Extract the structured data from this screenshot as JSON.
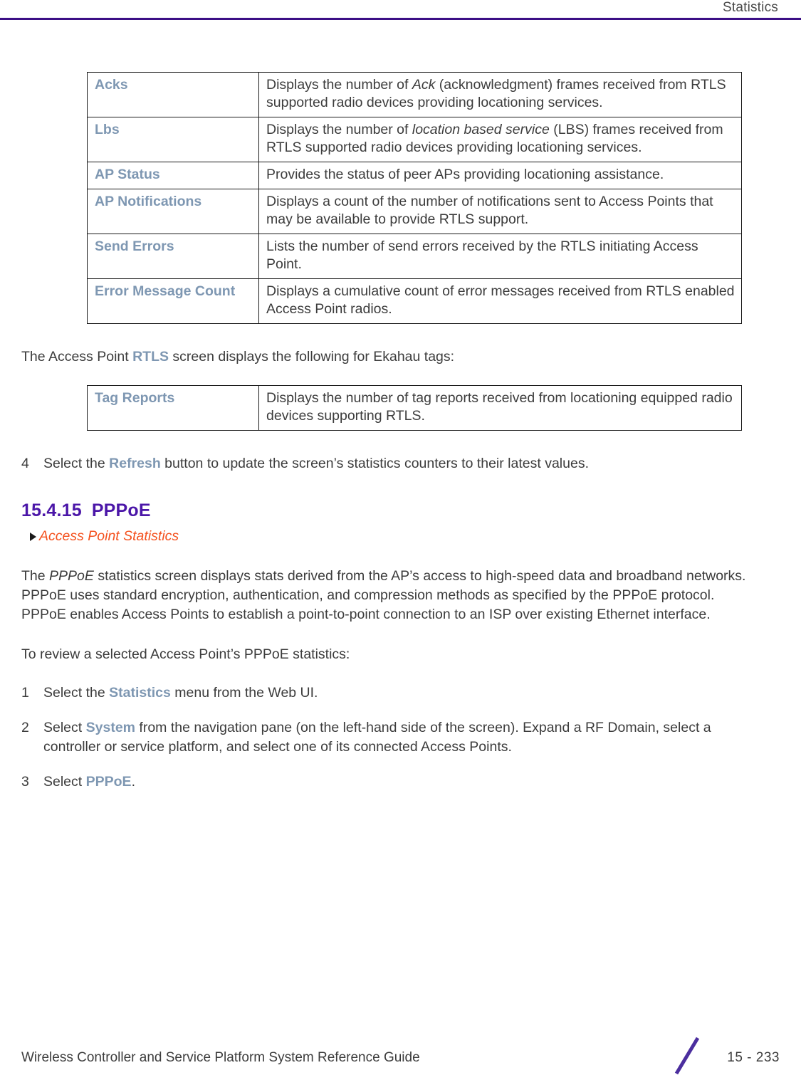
{
  "header": {
    "running_title": "Statistics"
  },
  "tables": [
    {
      "name": "rtls-statistics-table",
      "rows": [
        {
          "term": "Acks",
          "desc_parts": [
            {
              "text": "Displays the number of ",
              "style": "normal"
            },
            {
              "text": "Ack",
              "style": "italic"
            },
            {
              "text": " (acknowledgment) frames received from RTLS supported radio devices providing locationing services.",
              "style": "normal"
            }
          ]
        },
        {
          "term": "Lbs",
          "desc_parts": [
            {
              "text": "Displays the number of ",
              "style": "normal"
            },
            {
              "text": "location based service",
              "style": "italic"
            },
            {
              "text": " (LBS) frames received from RTLS supported radio devices providing locationing services.",
              "style": "normal"
            }
          ]
        },
        {
          "term": "AP Status",
          "desc_parts": [
            {
              "text": "Provides the status of peer APs providing locationing assistance.",
              "style": "normal"
            }
          ]
        },
        {
          "term": "AP Notifications",
          "desc_parts": [
            {
              "text": "Displays a count of the number of notifications sent to Access Points that may be available to provide RTLS support.",
              "style": "normal"
            }
          ]
        },
        {
          "term": "Send Errors",
          "desc_parts": [
            {
              "text": "Lists the number of send errors received by the RTLS initiating Access Point.",
              "style": "normal"
            }
          ]
        },
        {
          "term": "Error Message Count",
          "desc_parts": [
            {
              "text": "Displays a cumulative count of error messages received from RTLS enabled Access Point radios.",
              "style": "normal"
            }
          ]
        }
      ]
    },
    {
      "name": "ekahau-tags-table",
      "rows": [
        {
          "term": "Tag Reports",
          "desc_parts": [
            {
              "text": "Displays the number of tag reports received from locationing equipped radio devices supporting RTLS.",
              "style": "normal"
            }
          ]
        }
      ]
    }
  ],
  "ekahau_intro": {
    "before": "The Access Point ",
    "term": "RTLS",
    "after": " screen displays the following for Ekahau tags:"
  },
  "step_refresh": {
    "number": "4",
    "before": "Select the ",
    "term": "Refresh",
    "after": " button to update the screen’s statistics counters to their latest values."
  },
  "section": {
    "number": "15.4.15",
    "title": "PPPoE",
    "xref": "Access Point Statistics"
  },
  "body_paragraph": {
    "p1": "The ",
    "p1_italic": "PPPoE",
    "p2": " statistics screen displays stats derived from the AP’s access to high-speed data and broadband networks. PPPoE uses standard encryption, authentication, and compression methods as specified by the PPPoE protocol. PPPoE enables Access Points to establish a point-to-point connection to an ISP over existing Ethernet interface."
  },
  "review_intro": "To review a selected Access Point’s PPPoE statistics:",
  "steps": [
    {
      "number": "1",
      "before": "Select the ",
      "term": "Statistics",
      "after": " menu from the Web UI."
    },
    {
      "number": "2",
      "before": "Select ",
      "term": "System",
      "after": " from the navigation pane (on the left-hand side of the screen). Expand a RF Domain, select a controller or service platform, and select one of its connected Access Points."
    },
    {
      "number": "3",
      "before": "Select ",
      "term": "PPPoE",
      "after": "."
    }
  ],
  "footer": {
    "guide_title": "Wireless Controller and Service Platform System Reference Guide",
    "page_number": "15 - 233"
  },
  "colors": {
    "header_rule": "#3c0f86",
    "ui_term": "#7e97b2",
    "section_heading": "#4b16a8",
    "xref_link": "#f4511e",
    "body_text": "#3c3c3c",
    "table_border": "#1a1a1a"
  }
}
